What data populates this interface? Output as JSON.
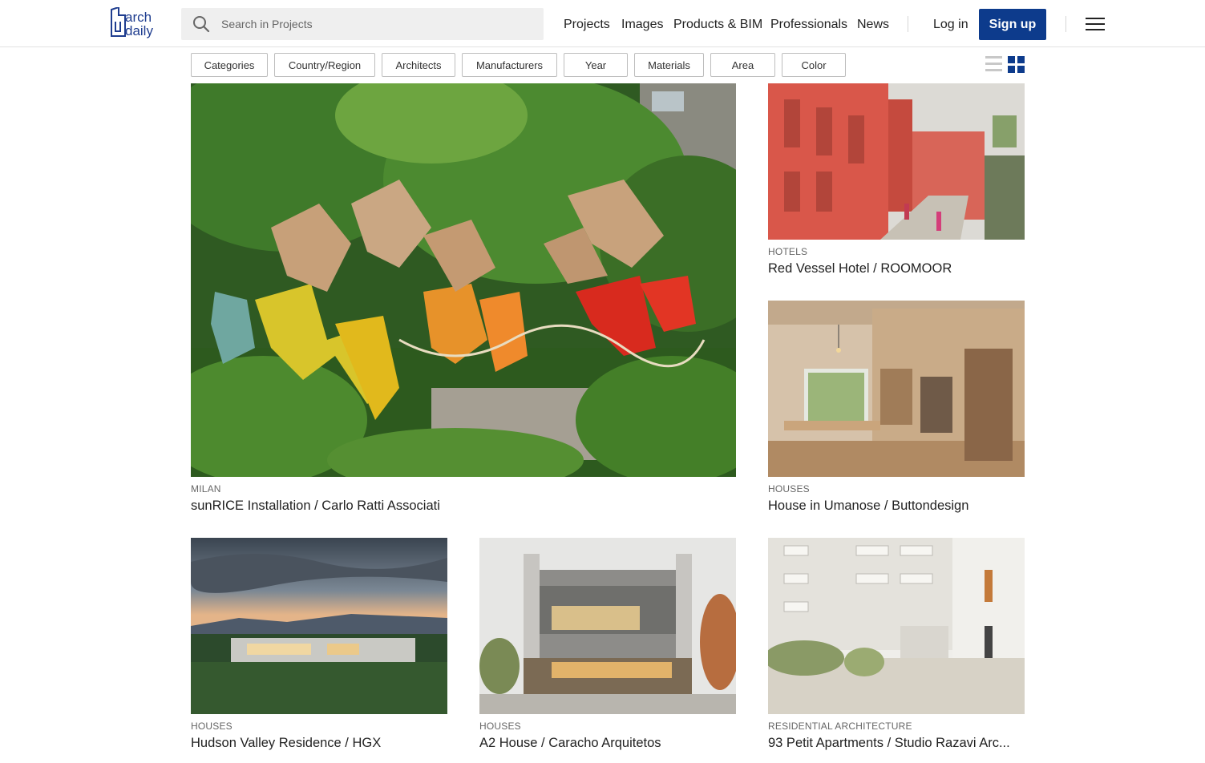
{
  "header": {
    "logo_line1": "arch",
    "logo_line2": "daily",
    "search_placeholder": "Search in Projects",
    "nav": [
      "Projects",
      "Images",
      "Products & BIM",
      "Professionals",
      "News"
    ],
    "login": "Log in",
    "signup": "Sign up",
    "brand_color": "#0d3b8c"
  },
  "filters": [
    "Categories",
    "Country/Region",
    "Architects",
    "Manufacturers",
    "Year",
    "Materials",
    "Area",
    "Color"
  ],
  "view_toggle": {
    "active": "grid"
  },
  "projects": [
    {
      "category": "MILAN",
      "title": "sunRICE Installation / Carlo Ratti Associati",
      "image": "garden-installation"
    },
    {
      "category": "HOTELS",
      "title": "Red Vessel Hotel / ROOMOOR",
      "image": "red-hotel-courtyard"
    },
    {
      "category": "HOUSES",
      "title": "House in Umanose / Buttondesign",
      "image": "wood-interior"
    },
    {
      "category": "HOUSES",
      "title": "Hudson Valley Residence / HGX",
      "image": "dusk-residence"
    },
    {
      "category": "HOUSES",
      "title": "A2 House / Caracho Arquitetos",
      "image": "concrete-house"
    },
    {
      "category": "RESIDENTIAL ARCHITECTURE",
      "title": "93 Petit Apartments / Studio Razavi Arc...",
      "image": "apartment-courtyard"
    }
  ]
}
